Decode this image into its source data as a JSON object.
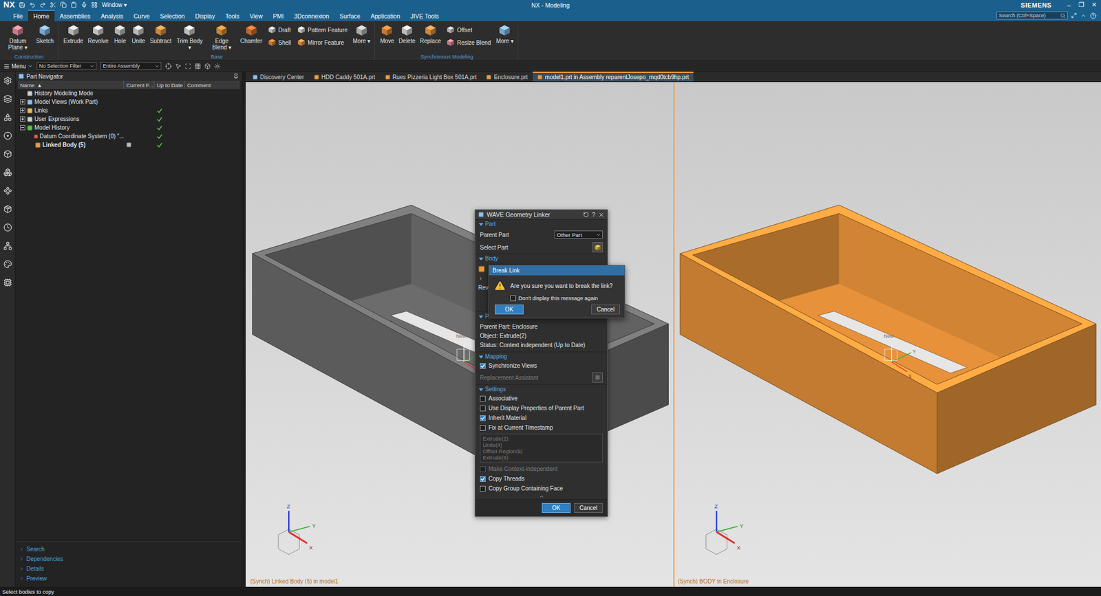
{
  "window": {
    "logo": "NX",
    "quick_menu": "Window",
    "caret": "▾",
    "title": "NX - Modeling",
    "brand": "SIEMENS",
    "controls": [
      "–",
      "❐",
      "✕"
    ]
  },
  "menu_tabs": [
    {
      "label": "File",
      "selected": false
    },
    {
      "label": "Home",
      "selected": true
    },
    {
      "label": "Assemblies",
      "selected": false
    },
    {
      "label": "Analysis",
      "selected": false
    },
    {
      "label": "Curve",
      "selected": false
    },
    {
      "label": "Selection",
      "selected": false
    },
    {
      "label": "Display",
      "selected": false
    },
    {
      "label": "Tools",
      "selected": false
    },
    {
      "label": "View",
      "selected": false
    },
    {
      "label": "PMI",
      "selected": false
    },
    {
      "label": "3Dconnexion",
      "selected": false
    },
    {
      "label": "Surface",
      "selected": false
    },
    {
      "label": "Application",
      "selected": false
    },
    {
      "label": "JIVE Tools",
      "selected": false
    }
  ],
  "search": {
    "placeholder": "Search (Ctrl+Space)"
  },
  "ribbon": {
    "groups": [
      {
        "label": "Construction",
        "items": [
          {
            "kind": "large",
            "label": "Datum Plane",
            "menu": true
          },
          {
            "kind": "large",
            "label": "Sketch",
            "menu": false
          }
        ]
      },
      {
        "label": "Base",
        "items": [
          {
            "kind": "large",
            "label": "Extrude",
            "menu": false
          },
          {
            "kind": "large",
            "label": "Revolve",
            "menu": false
          },
          {
            "kind": "large",
            "label": "Hole",
            "menu": false
          },
          {
            "kind": "large",
            "label": "Unite",
            "menu": false
          },
          {
            "kind": "large",
            "label": "Subtract",
            "menu": false
          },
          {
            "kind": "large",
            "label": "Trim Body",
            "menu": true
          },
          {
            "kind": "large",
            "label": "Edge Blend",
            "menu": true
          },
          {
            "kind": "large",
            "label": "Chamfer",
            "menu": false
          },
          {
            "kind": "stack",
            "items": [
              {
                "label": "Draft"
              },
              {
                "label": "Shell"
              }
            ]
          },
          {
            "kind": "stack",
            "items": [
              {
                "label": "Pattern Feature"
              },
              {
                "label": "Mirror Feature"
              }
            ]
          },
          {
            "kind": "large",
            "label": "More",
            "menu": true
          }
        ]
      },
      {
        "label": "Synchronous Modeling",
        "items": [
          {
            "kind": "large",
            "label": "Move",
            "menu": false
          },
          {
            "kind": "large",
            "label": "Delete",
            "menu": false
          },
          {
            "kind": "large",
            "label": "Replace",
            "menu": false
          },
          {
            "kind": "stack",
            "items": [
              {
                "label": "Offset"
              },
              {
                "label": "Resize Blend"
              }
            ]
          },
          {
            "kind": "large",
            "label": "More",
            "menu": true
          }
        ]
      }
    ]
  },
  "selection_bar": {
    "menu_label": "Menu",
    "filter": "No Selection Filter",
    "scope": "Entire Assembly"
  },
  "part_navigator": {
    "title": "Part Navigator",
    "sort_glyph": "▲",
    "columns": [
      "Name",
      "Current F...",
      "Up to Date",
      "Comment"
    ],
    "rows": [
      {
        "label": "History Modeling Mode",
        "depth": 0,
        "expandable": false,
        "expanded": false,
        "up_to_date": false,
        "current": false,
        "bold": false
      },
      {
        "label": "Model Views (Work Part)",
        "depth": 0,
        "expandable": true,
        "expanded": false,
        "up_to_date": false,
        "current": false,
        "bold": false
      },
      {
        "label": "Links",
        "depth": 0,
        "expandable": true,
        "expanded": false,
        "up_to_date": true,
        "current": false,
        "bold": false
      },
      {
        "label": "User Expressions",
        "depth": 0,
        "expandable": true,
        "expanded": false,
        "up_to_date": true,
        "current": false,
        "bold": false
      },
      {
        "label": "Model History",
        "depth": 0,
        "expandable": true,
        "expanded": true,
        "up_to_date": true,
        "current": false,
        "bold": false
      },
      {
        "label": "Datum Coordinate System (0) \"...",
        "depth": 1,
        "expandable": false,
        "expanded": false,
        "up_to_date": true,
        "current": false,
        "bold": false
      },
      {
        "label": "Linked Body (5)",
        "depth": 1,
        "expandable": false,
        "expanded": false,
        "up_to_date": true,
        "current": true,
        "bold": true
      }
    ],
    "footer": [
      "Search",
      "Dependencies",
      "Details",
      "Preview"
    ]
  },
  "document_tabs": [
    {
      "label": "Discovery Center",
      "selected": false
    },
    {
      "label": "HDD Caddy 501A.prt",
      "selected": false
    },
    {
      "label": "Rues Pizzeria Light Box 501A.prt",
      "selected": false
    },
    {
      "label": "Enclosure.prt",
      "selected": false
    },
    {
      "label": "model1.prt in Assembly reparentJosepo_mqd0tcb9hp.prt",
      "selected": true
    }
  ],
  "viewports": [
    {
      "label": "(Synch) Linked Body (5) in model1",
      "color": "#727272",
      "work_view": false,
      "csys_label": "New",
      "csys_axes_visible": false
    },
    {
      "label": "(Synch) BODY in Enclosure",
      "color": "#f39a3d",
      "work_view": true,
      "csys_label": "New",
      "csys_axes_visible": true
    }
  ],
  "triad_labels": [
    "Z",
    "Y",
    "X"
  ],
  "dialog": {
    "title": "WAVE Geometry Linker",
    "help": "?",
    "part_section": {
      "label": "Part",
      "expanded": true,
      "parent_part_label": "Parent Part",
      "parent_part_value": "Other Part",
      "select_part_label": "Select Part"
    },
    "body_section": {
      "label": "Body",
      "expanded": true,
      "clipped_label": "Rev"
    },
    "info_section": {
      "clipped_label": "P",
      "expanded": true,
      "lines": [
        "Parent Part: Enclosure",
        "Object: Extrude(2)",
        "Status: Context independent (Up to Date)"
      ]
    },
    "mapping_section": {
      "label": "Mapping",
      "expanded": true,
      "options": [
        {
          "kind": "checkbox",
          "label": "Synchronize Views",
          "checked": true,
          "disabled": false
        },
        {
          "kind": "button",
          "label": "Replacement Assistant",
          "disabled": true
        }
      ]
    },
    "settings_section": {
      "label": "Settings",
      "expanded": true,
      "options": [
        {
          "kind": "checkbox",
          "label": "Associative",
          "checked": false,
          "disabled": false
        },
        {
          "kind": "checkbox",
          "label": "Use Display Properties of Parent Part",
          "checked": false,
          "disabled": false
        },
        {
          "kind": "checkbox",
          "label": "Inherit Material",
          "checked": true,
          "disabled": false
        },
        {
          "kind": "checkbox",
          "label": "Fix at Current Timestamp",
          "checked": false,
          "disabled": false
        },
        {
          "kind": "list",
          "items": [
            "Extrude(2)",
            "Unite(4)",
            "Offset Region(5)",
            "Extrude(6)"
          ],
          "disabled": true
        },
        {
          "kind": "checkbox",
          "label": "Make Context-independent",
          "checked": false,
          "disabled": true
        },
        {
          "kind": "checkbox",
          "label": "Copy Threads",
          "checked": true,
          "disabled": false
        },
        {
          "kind": "checkbox",
          "label": "Copy Group Containing Face",
          "checked": false,
          "disabled": false
        }
      ]
    },
    "buttons": [
      {
        "label": "OK",
        "primary": true
      },
      {
        "label": "Cancel",
        "primary": false
      }
    ]
  },
  "break_link_dialog": {
    "title": "Break Link",
    "message": "Are you sure you want to break the link?",
    "checkbox": {
      "label": "Don't display this message again",
      "checked": false
    },
    "buttons": [
      {
        "label": "OK",
        "primary": true
      },
      {
        "label": "Cancel",
        "primary": false
      }
    ]
  },
  "status_bar": {
    "text": "Select bodies to copy"
  }
}
